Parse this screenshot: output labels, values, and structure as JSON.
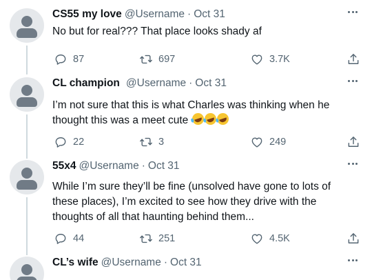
{
  "tweets": [
    {
      "name": "CS55 my love",
      "handle": "@Username",
      "separator": "·",
      "date": "Oct 31",
      "text": "No but for real??? That place looks shady af",
      "replies": "87",
      "retweets": "697",
      "likes": "3.7K"
    },
    {
      "name": "CL champion",
      "handle": "@Username",
      "separator": "·",
      "date": "Oct 31",
      "text": "I’m not sure that this is what Charles was thinking when he thought this was a meet cute",
      "emoji": [
        "rolling-on-floor-laughing",
        "rolling-on-floor-laughing",
        "rolling-on-floor-laughing"
      ],
      "replies": "22",
      "retweets": "3",
      "likes": "249"
    },
    {
      "name": "55x4",
      "handle": "@Username",
      "separator": "·",
      "date": "Oct 31",
      "text": "While I’m sure they’ll be fine (unsolved have gone to lots of these places), I’m excited to see how they drive with the thoughts of all that haunting behind them...",
      "replies": "44",
      "retweets": "251",
      "likes": "4.5K"
    },
    {
      "name": "CL’s wife",
      "handle": "@Username",
      "separator": "·",
      "date": "Oct 31"
    }
  ],
  "icons": {
    "reply": "reply-icon",
    "retweet": "retweet-icon",
    "like": "heart-icon",
    "share": "share-icon",
    "more": "more-icon"
  },
  "colors": {
    "text": "#0f1419",
    "secondary": "#536471",
    "thread_line": "#cfd9de",
    "avatar_bg": "#e5e8eb",
    "avatar_fg": "#707b86"
  }
}
